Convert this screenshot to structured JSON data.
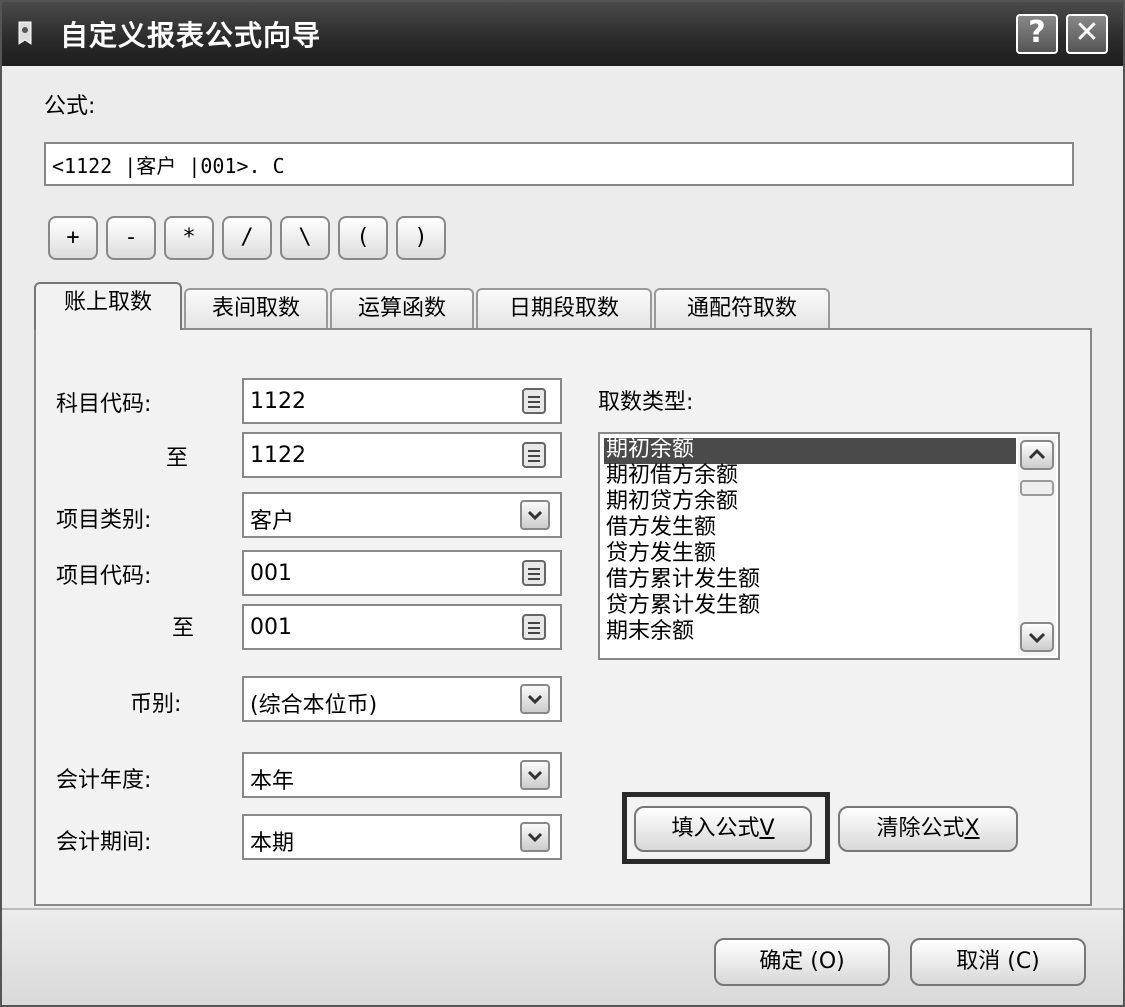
{
  "window": {
    "title": "自定义报表公式向导",
    "help_label": "?",
    "close_label": "✕"
  },
  "formula": {
    "label": "公式:",
    "value": "<1122 |客户 |001>. C"
  },
  "operators": [
    "+",
    "-",
    "*",
    "/",
    "\\",
    "(",
    ")"
  ],
  "tabs": [
    "账上取数",
    "表间取数",
    "运算函数",
    "日期段取数",
    "通配符取数"
  ],
  "fields": {
    "account_code_label": "科目代码:",
    "account_code": "1122",
    "to_label": "至",
    "account_code_to": "1122",
    "item_category_label": "项目类别:",
    "item_category": "客户",
    "item_code_label": "项目代码:",
    "item_code": "001",
    "item_code_to": "001",
    "currency_label": "币别:",
    "currency": "(综合本位币)",
    "fiscal_year_label": "会计年度:",
    "fiscal_year": "本年",
    "period_label": "会计期间:",
    "period": "本期"
  },
  "fetch_type": {
    "label": "取数类型:",
    "items": [
      "期初余额",
      "期初借方余额",
      "期初贷方余额",
      "借方发生额",
      "贷方发生额",
      "借方累计发生额",
      "贷方累计发生额",
      "期末余额"
    ],
    "selected_index": 0
  },
  "buttons": {
    "fill_formula": "填入公式",
    "fill_formula_key": "V",
    "clear_formula": "清除公式",
    "clear_formula_key": "X",
    "ok": "确定",
    "ok_key": "(O)",
    "cancel": "取消",
    "cancel_key": "(C)"
  },
  "colors": {
    "title_bar": "#2e2e2e",
    "selection": "#4a4a4a",
    "highlight_box": "#2a2a2a"
  }
}
